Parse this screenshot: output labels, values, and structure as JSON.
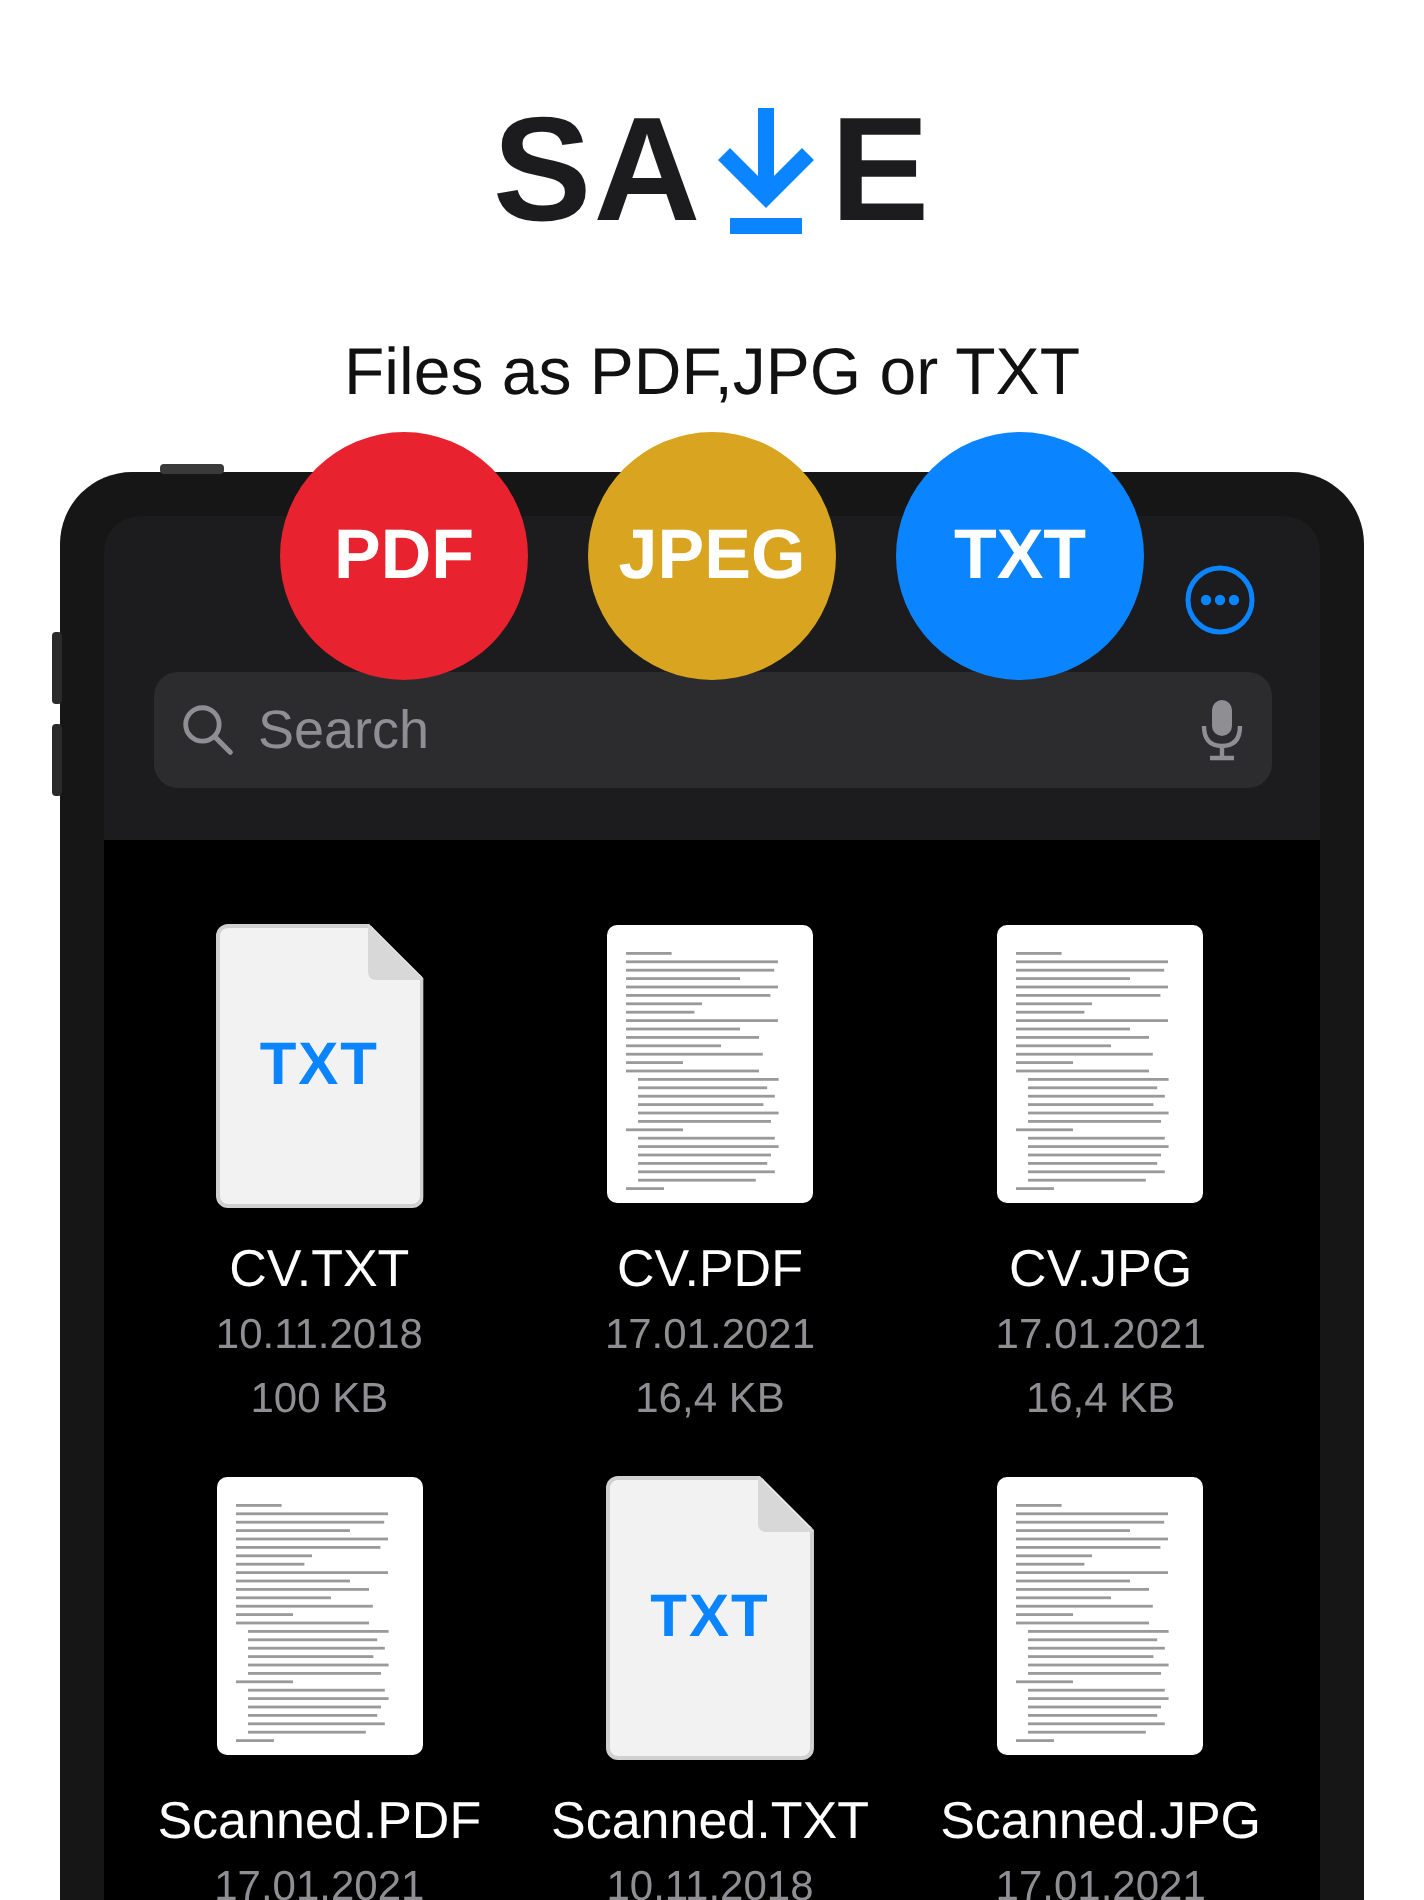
{
  "logo": {
    "before": "SA",
    "after": "E"
  },
  "tagline": "Files as PDF,JPG or TXT",
  "formats": [
    {
      "label": "PDF",
      "color": "#e8222e"
    },
    {
      "label": "JPEG",
      "color": "#d9a520"
    },
    {
      "label": "TXT",
      "color": "#0a84ff"
    }
  ],
  "search": {
    "placeholder": "Search"
  },
  "files": [
    {
      "kind": "txt",
      "badge": "TXT",
      "name": "CV.TXT",
      "date": "10.11.2018",
      "size": "100 KB"
    },
    {
      "kind": "doc",
      "name": "CV.PDF",
      "date": "17.01.2021",
      "size": "16,4 KB"
    },
    {
      "kind": "doc",
      "name": "CV.JPG",
      "date": "17.01.2021",
      "size": "16,4 KB"
    },
    {
      "kind": "doc",
      "name": "Scanned.PDF",
      "date": "17.01.2021"
    },
    {
      "kind": "txt",
      "badge": "TXT",
      "name": "Scanned.TXT",
      "date": "10.11.2018"
    },
    {
      "kind": "doc",
      "name": "Scanned.JPG",
      "date": "17.01.2021"
    }
  ]
}
